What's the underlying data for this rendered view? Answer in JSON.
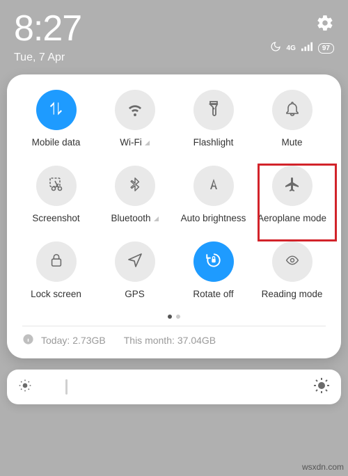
{
  "status": {
    "time": "8:27",
    "date": "Tue, 7 Apr",
    "network_type": "4G",
    "battery": "97"
  },
  "tiles": {
    "mobile_data": "Mobile data",
    "wifi": "Wi-Fi",
    "flashlight": "Flashlight",
    "mute": "Mute",
    "screenshot": "Screenshot",
    "bluetooth": "Bluetooth",
    "auto_brightness": "Auto brightness",
    "aeroplane_mode": "Aeroplane mode",
    "lock_screen": "Lock screen",
    "gps": "GPS",
    "rotate_off": "Rotate off",
    "reading_mode": "Reading mode"
  },
  "usage": {
    "today_label": "Today:",
    "today_value": "2.73GB",
    "month_label": "This month:",
    "month_value": "37.04GB"
  },
  "watermark": "wsxdn.com"
}
